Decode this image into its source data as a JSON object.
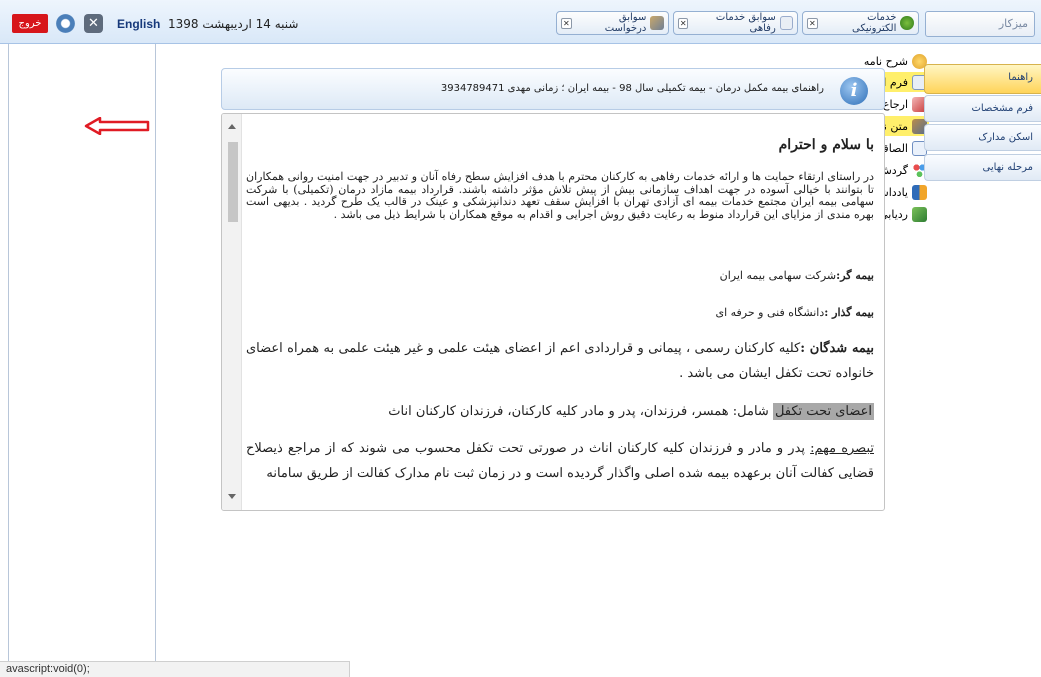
{
  "topbar": {
    "exit_label": "خروج",
    "lang_label": "English",
    "date_text": "شنبه 14 اردیبهشت 1398",
    "tabs": [
      {
        "label": "سوابق درخواست"
      },
      {
        "label": "سوابق خدمات رفاهی"
      },
      {
        "label": "خدمات الکترونیکی"
      }
    ],
    "desk_label": "میزکار"
  },
  "leftnav": {
    "items": [
      {
        "label": "شرح نامه",
        "icon": "shell-icon"
      },
      {
        "label": "فرم الصاقی",
        "icon": "document-icon"
      },
      {
        "label": "ارجاع ها",
        "icon": "refer-icon"
      },
      {
        "label": "متن نامه",
        "icon": "tools-icon"
      },
      {
        "label": "الصاقی نامه",
        "icon": "mail-icon"
      },
      {
        "label": "گردش کار",
        "icon": "workflow-icon"
      },
      {
        "label": "یادداشت",
        "icon": "note-icon"
      },
      {
        "label": "ردیابی",
        "icon": "tracking-icon"
      }
    ]
  },
  "main": {
    "header_text": "راهنمای بیمه مکمل درمان - بیمه تکمیلی سال 98 - بیمه ایران ؛ زمانی مهدی 3934789471",
    "doc": {
      "greeting": "با سلام و احترام",
      "intro": "در راستای ارتقاء حمایت ها و ارائه خدمات رفاهی به کارکنان محترم با هدف افزایش سطح رفاه آنان و تدبیر در جهت امنیت روانی همکاران تا بتوانند با خیالی آسوده در جهت اهداف سازمانی بیش از پیش تلاش مؤثر داشته باشند. قرارداد بیمه مازاد درمان (تکمیلی) با شرکت سهامی بیمه ایران مجتمع خدمات بیمه ای آزادی تهران با افزایش سقف تعهد دندانپزشکی و عینک در قالب یک طرح گردید . بدیهی است بهره مندی از مزایای این قرارداد منوط به رعایت دقیق روش اجرایی و اقدام به موقع همکاران با شرایط ذیل می باشد .",
      "insurer_label": "بیمه گر:",
      "insurer_value": "شرکت سهامی بیمه ایران",
      "policyholder_label": "بیمه گذار :",
      "policyholder_value": "دانشگاه فنی و حرفه ای",
      "insured_label": "بیمه شدگان :",
      "insured_value": "کلیه کارکنان رسمی ، پیمانی و قراردادی اعم از اعضای هیئت علمی و غیر هیئت علمی به همراه اعضای خانواده تحت تکفل ایشان می باشد .",
      "dependents_label": "اعضای تحت تکفل",
      "dependents_value": " شامل: همسر، فرزندان، پدر و مادر کلیه کارکنان، فرزندان کارکنان اناث",
      "note_label": "تبصره مهم:",
      "note_value": " پدر و مادر و فرزندان کلیه کارکنان اناث در صورتی تحت تکفل محسوب می شوند که از مراجع ذیصلاح قضایی کفالت آنان برعهده بیمه شده اصلی واگذار گردیده است و در زمان ثبت نام مدارک کفالت از طریق سامانه"
    }
  },
  "righttabs": [
    {
      "label": "راهنما"
    },
    {
      "label": "فرم مشخصات"
    },
    {
      "label": "اسکن مدارک"
    },
    {
      "label": "مرحله نهایی"
    }
  ],
  "status": {
    "text": "avascript:void(0);"
  },
  "colors": {
    "accent_red": "#d7161b",
    "highlight_yellow": "#ffef6b",
    "arrow_red": "#e01b24"
  }
}
